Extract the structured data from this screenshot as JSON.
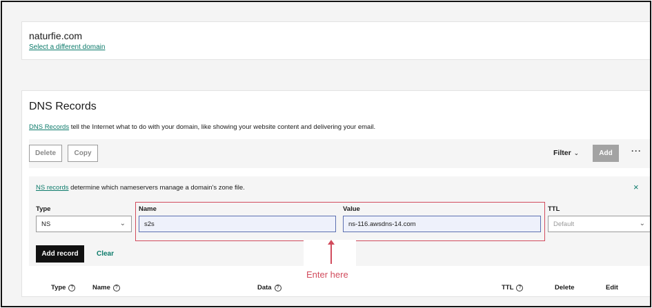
{
  "domain": {
    "name": "naturfie.com",
    "change_link": "Select a different domain"
  },
  "dns": {
    "title": "DNS Records",
    "desc_link": "DNS Records",
    "desc_rest": " tell the Internet what to do with your domain, like showing your website content and delivering your email."
  },
  "toolbar": {
    "delete_label": "Delete",
    "copy_label": "Copy",
    "filter_label": "Filter",
    "add_label": "Add",
    "more_label": "···"
  },
  "form": {
    "info_link": "NS records",
    "info_rest": " determine which nameservers manage a domain's zone file.",
    "close_label": "×",
    "type_label": "Type",
    "type_value": "NS",
    "name_label": "Name",
    "name_value": "s2s",
    "value_label": "Value",
    "value_value": "ns-116.awsdns-14.com",
    "ttl_label": "TTL",
    "ttl_placeholder": "Default",
    "add_record_label": "Add record",
    "clear_label": "Clear"
  },
  "table": {
    "headers": [
      "Type",
      "Name",
      "Data",
      "TTL",
      "Delete",
      "Edit"
    ]
  },
  "annotation": {
    "text": "Enter here",
    "color": "#d14b5c"
  },
  "colors": {
    "accent": "#0b7a6a",
    "primary_button": "#111111",
    "disabled_button": "#a3a3a3"
  }
}
